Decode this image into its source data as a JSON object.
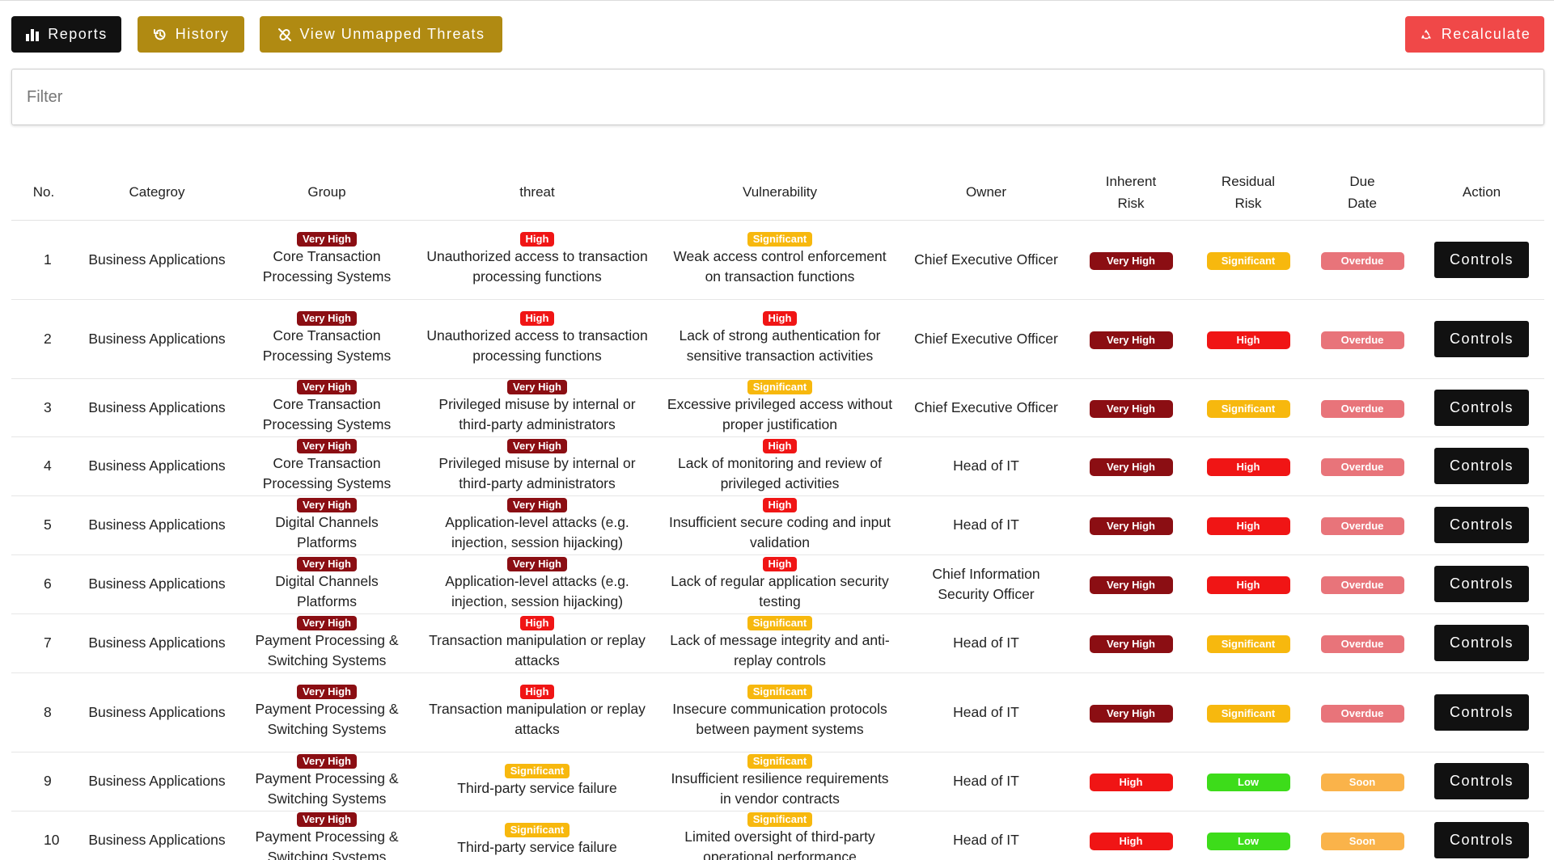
{
  "toolbar": {
    "reports_label": "Reports",
    "history_label": "History",
    "unmapped_label": "View Unmapped Threats",
    "recalculate_label": "Recalculate"
  },
  "filter": {
    "placeholder": "Filter",
    "value": ""
  },
  "colors": {
    "very_high": "#8b0e13",
    "high": "#f01515",
    "significant": "#f7b80e",
    "low": "#3ddc1a",
    "overdue": "#e8747a",
    "soon": "#fab34a",
    "gold_button": "#b08a12",
    "red_button": "#f04848",
    "dark_button": "#111111"
  },
  "table": {
    "headers": {
      "no": "No.",
      "category": "Categroy",
      "group": "Group",
      "threat": "threat",
      "vulnerability": "Vulnerability",
      "owner": "Owner",
      "inherent_line1": "Inherent",
      "inherent_line2": "Risk",
      "residual_line1": "Residual",
      "residual_line2": "Risk",
      "due_line1": "Due",
      "due_line2": "Date",
      "action": "Action"
    },
    "rows": [
      {
        "no": "1",
        "category": "Business Applications",
        "group_badge": "Very High",
        "group": "Core Transaction Processing Systems",
        "threat_badge": "High",
        "threat": "Unauthorized access to transaction processing functions",
        "vuln_badge": "Significant",
        "vulnerability": "Weak access control enforcement on transaction functions",
        "owner": "Chief Executive Officer",
        "inherent": "Very High",
        "residual": "Significant",
        "due": "Overdue",
        "action": "Controls"
      },
      {
        "no": "2",
        "category": "Business Applications",
        "group_badge": "Very High",
        "group": "Core Transaction Processing Systems",
        "threat_badge": "High",
        "threat": "Unauthorized access to transaction processing functions",
        "vuln_badge": "High",
        "vulnerability": "Lack of strong authentication for sensitive transaction activities",
        "owner": "Chief Executive Officer",
        "inherent": "Very High",
        "residual": "High",
        "due": "Overdue",
        "action": "Controls"
      },
      {
        "no": "3",
        "category": "Business Applications",
        "group_badge": "Very High",
        "group": "Core Transaction Processing Systems",
        "threat_badge": "Very High",
        "threat": "Privileged misuse by internal or third-party administrators",
        "vuln_badge": "Significant",
        "vulnerability": "Excessive privileged access without proper justification",
        "owner": "Chief Executive Officer",
        "inherent": "Very High",
        "residual": "Significant",
        "due": "Overdue",
        "action": "Controls"
      },
      {
        "no": "4",
        "category": "Business Applications",
        "group_badge": "Very High",
        "group": "Core Transaction Processing Systems",
        "threat_badge": "Very High",
        "threat": "Privileged misuse by internal or third-party administrators",
        "vuln_badge": "High",
        "vulnerability": "Lack of monitoring and review of privileged activities",
        "owner": "Head of IT",
        "inherent": "Very High",
        "residual": "High",
        "due": "Overdue",
        "action": "Controls"
      },
      {
        "no": "5",
        "category": "Business Applications",
        "group_badge": "Very High",
        "group": "Digital Channels Platforms",
        "threat_badge": "Very High",
        "threat": "Application-level attacks (e.g. injection, session hijacking)",
        "vuln_badge": "High",
        "vulnerability": "Insufficient secure coding and input validation",
        "owner": "Head of IT",
        "inherent": "Very High",
        "residual": "High",
        "due": "Overdue",
        "action": "Controls"
      },
      {
        "no": "6",
        "category": "Business Applications",
        "group_badge": "Very High",
        "group": "Digital Channels Platforms",
        "threat_badge": "Very High",
        "threat": "Application-level attacks (e.g. injection, session hijacking)",
        "vuln_badge": "High",
        "vulnerability": "Lack of regular application security testing",
        "owner": "Chief Information Security Officer",
        "inherent": "Very High",
        "residual": "High",
        "due": "Overdue",
        "action": "Controls"
      },
      {
        "no": "7",
        "category": "Business Applications",
        "group_badge": "Very High",
        "group": "Payment Processing & Switching Systems",
        "threat_badge": "High",
        "threat": "Transaction manipulation or replay attacks",
        "vuln_badge": "Significant",
        "vulnerability": "Lack of message integrity and anti-replay controls",
        "owner": "Head of IT",
        "inherent": "Very High",
        "residual": "Significant",
        "due": "Overdue",
        "action": "Controls"
      },
      {
        "no": "8",
        "category": "Business Applications",
        "group_badge": "Very High",
        "group": "Payment Processing & Switching Systems",
        "threat_badge": "High",
        "threat": "Transaction manipulation or replay attacks",
        "vuln_badge": "Significant",
        "vulnerability": "Insecure communication protocols between payment systems",
        "owner": "Head of IT",
        "inherent": "Very High",
        "residual": "Significant",
        "due": "Overdue",
        "action": "Controls"
      },
      {
        "no": "9",
        "category": "Business Applications",
        "group_badge": "Very High",
        "group": "Payment Processing & Switching Systems",
        "threat_badge": "Significant",
        "threat": "Third-party service failure",
        "vuln_badge": "Significant",
        "vulnerability": "Insufficient resilience requirements in vendor contracts",
        "owner": "Head of IT",
        "inherent": "High",
        "residual": "Low",
        "due": "Soon",
        "action": "Controls"
      },
      {
        "no": "10",
        "category": "Business Applications",
        "group_badge": "Very High",
        "group": "Payment Processing & Switching Systems",
        "threat_badge": "Significant",
        "threat": "Third-party service failure",
        "vuln_badge": "Significant",
        "vulnerability": "Limited oversight of third-party operational performance",
        "owner": "Head of IT",
        "inherent": "High",
        "residual": "Low",
        "due": "Soon",
        "action": "Controls"
      }
    ]
  }
}
